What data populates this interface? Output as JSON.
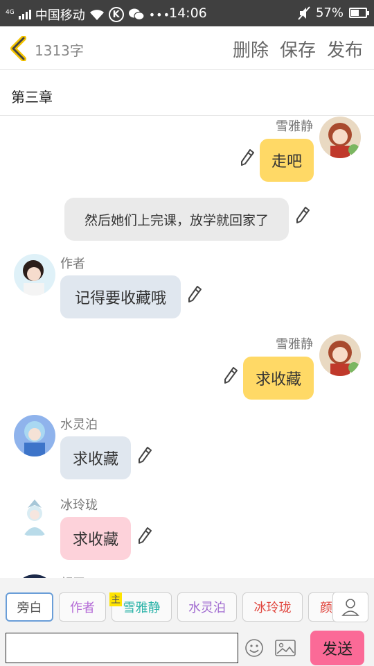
{
  "status_bar": {
    "network": "4G",
    "carrier": "中国移动",
    "time": "14:06",
    "battery": "57%",
    "battery_level": 0.57,
    "icons": [
      "signal-icon",
      "wifi-icon",
      "k-app-icon",
      "wechat-icon",
      "more-icon",
      "mute-icon",
      "battery-icon"
    ]
  },
  "header": {
    "word_count": "1313字",
    "actions": [
      "删除",
      "保存",
      "发布"
    ],
    "accent_color": "#f5c400"
  },
  "chapter": {
    "title": "第三章"
  },
  "messages": [
    {
      "speaker": "雪雅静",
      "text": "走吧"
    },
    {
      "text": "然后她们上完课，放学就回家了"
    },
    {
      "speaker": "作者",
      "text": "记得要收藏哦"
    },
    {
      "speaker": "雪雅静",
      "text": "求收藏"
    },
    {
      "speaker": "水灵泊",
      "text": "求收藏"
    },
    {
      "speaker": "冰玲珑",
      "text": "求收藏"
    },
    {
      "speaker": "颜王"
    }
  ],
  "roles": {
    "items": [
      {
        "label": "旁白",
        "color": "#555555"
      },
      {
        "label": "作者",
        "color": "#b46ad6"
      },
      {
        "label": "雪雅静",
        "color": "#2bb3a8"
      },
      {
        "label": "水灵泊",
        "color": "#a06ad0"
      },
      {
        "label": "冰玲珑",
        "color": "#e0443c"
      },
      {
        "label": "颜",
        "color": "#e0443c"
      }
    ],
    "main_tag": "主"
  },
  "input": {
    "value": "",
    "send_label": "发送"
  }
}
